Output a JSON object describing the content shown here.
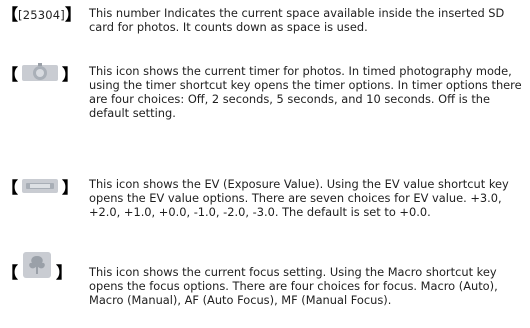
{
  "entries": [
    {
      "marker_text": "25304",
      "description": "This number Indicates the current space available inside the inserted SD card for photos. It counts down as space is used."
    },
    {
      "icon": "timer-icon",
      "description": "This icon shows the current timer for photos. In timed photography mode, using the timer shortcut key opens the timer options. In timer options there are four choices: Off, 2 seconds, 5 seconds, and 10 seconds. Off is the default setting."
    },
    {
      "icon": "ev-icon",
      "description": "This icon shows the EV (Exposure Value). Using the EV value shortcut key opens the EV value options. There are seven choices for EV value. +3.0, +2.0, +1.0, +0.0, -1.0, -2.0, -3.0. The default is set to +0.0."
    },
    {
      "icon": "focus-icon",
      "description": "This icon shows the current focus setting. Using the Macro shortcut key opens the focus options. There are four choices for focus. Macro (Auto), Macro (Manual), AF (Auto Focus), MF (Manual Focus)."
    }
  ],
  "colors": {
    "icon_fill": "#c9ccd2",
    "icon_shade": "#9aa0a8",
    "text": "#1e1e1e"
  }
}
